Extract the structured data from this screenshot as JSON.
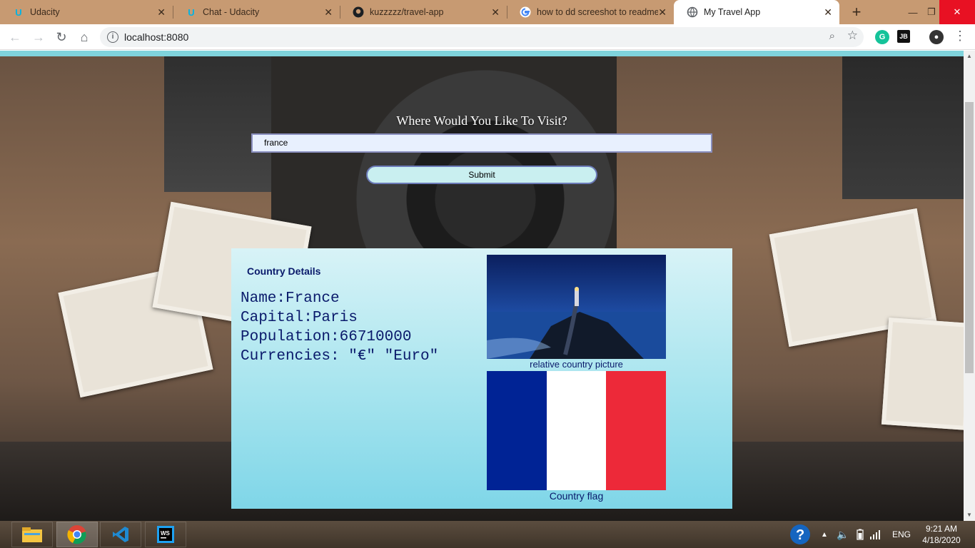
{
  "tabs": [
    {
      "title": "Udacity",
      "icon": "udacity-icon"
    },
    {
      "title": "Chat - Udacity",
      "icon": "udacity-icon"
    },
    {
      "title": "kuzzzzz/travel-app",
      "icon": "github-icon"
    },
    {
      "title": "how to dd screeshot to readme",
      "icon": "google-icon"
    },
    {
      "title": "My Travel App",
      "icon": "globe-icon",
      "active": true
    }
  ],
  "address_bar": {
    "url": "localhost:8080"
  },
  "page": {
    "prompt": "Where Would You Like To Visit?",
    "input_value": "france",
    "submit_label": "Submit",
    "details_heading": "Country Details",
    "details": {
      "name": "Name:France",
      "capital": "Capital:Paris",
      "population": "Population:66710000",
      "currencies": "Currencies: \"€\" \"Euro\""
    },
    "picture_caption": "relative country picture",
    "flag_caption": "Country flag",
    "flag_colors": [
      "#002395",
      "#ffffff",
      "#ed2939"
    ]
  },
  "taskbar": {
    "language": "ENG",
    "time": "9:21 AM",
    "date": "4/18/2020"
  }
}
